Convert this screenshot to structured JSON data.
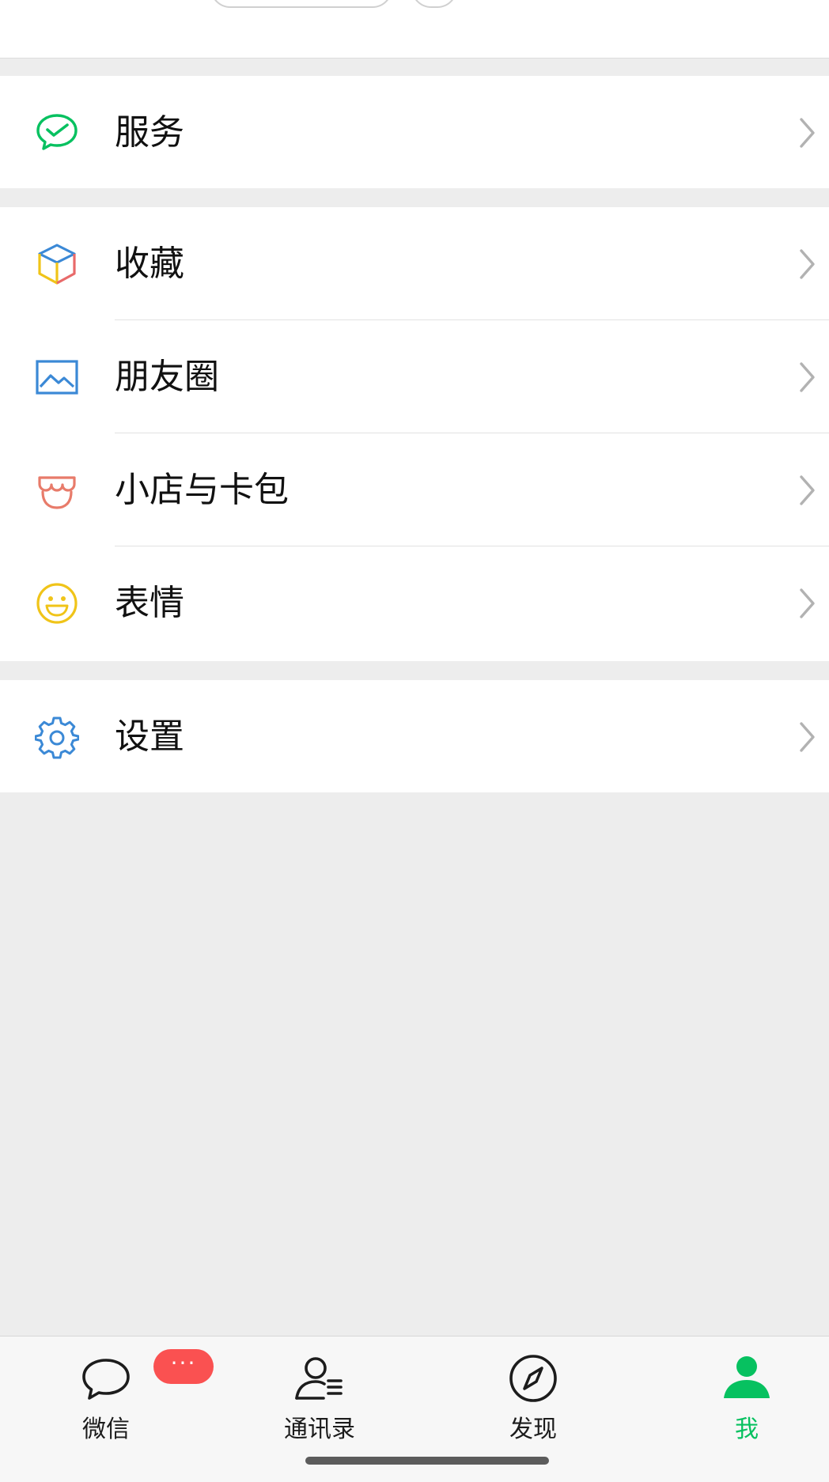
{
  "menu": {
    "services": {
      "label": "服务",
      "icon": "wechat-pay-check-icon",
      "color": "#07c160"
    },
    "favorites": {
      "label": "收藏",
      "icon": "cube-icon"
    },
    "moments": {
      "label": "朋友圈",
      "icon": "picture-icon",
      "color": "#3b89d6"
    },
    "shop_cards": {
      "label": "小店与卡包",
      "icon": "shop-icon",
      "color": "#e87b6a"
    },
    "stickers": {
      "label": "表情",
      "icon": "smiley-icon",
      "color": "#f0c419"
    },
    "settings": {
      "label": "设置",
      "icon": "gear-icon",
      "color": "#3b89d6"
    }
  },
  "tabbar": {
    "tabs": [
      {
        "label": "微信",
        "icon": "chat-bubble-icon",
        "badge": "···"
      },
      {
        "label": "通讯录",
        "icon": "contacts-icon"
      },
      {
        "label": "发现",
        "icon": "compass-icon"
      },
      {
        "label": "我",
        "icon": "person-icon",
        "active": true
      }
    ],
    "active_color": "#07c160"
  }
}
